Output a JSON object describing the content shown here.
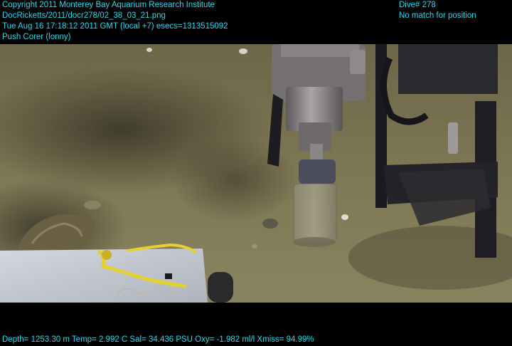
{
  "overlay": {
    "top_left": [
      "Copyright 2011 Monterey Bay Aquarium Research Institute",
      "DocRicketts/2011/docr278/02_38_03_21.png",
      "Tue Aug 16 17:18:12 2011 GMT (local +7)  esecs=1313515092",
      "Push Corer (lonny)"
    ],
    "top_right": [
      "Dive# 278",
      "No match for position"
    ],
    "bottom": "Depth= 1253.30 m  Temp= 2.992 C  Sal= 34.436 PSU  Oxy= -1.982 ml/l  Xmiss= 94.99%"
  },
  "colors": {
    "overlay_text": "#29d9ee",
    "seafloor": "#7d7552",
    "panel": "#c6cbd4",
    "hose": "#e3d12c"
  }
}
